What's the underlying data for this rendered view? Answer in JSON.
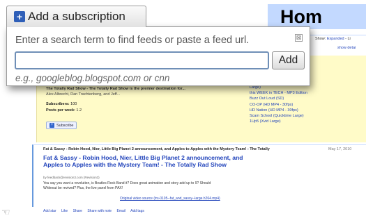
{
  "header": {
    "add_subscription_label": "Add a subscription",
    "page_title": "Hom"
  },
  "subscribe_popup": {
    "hint": "Enter a search term to find feeds or paste a feed url.",
    "input_value": "",
    "add_button_label": "Add",
    "close_glyph": "⊠",
    "example": "e.g., googleblog.blogspot.com or cnn"
  },
  "reader": {
    "toolbar": {
      "show_prefix": "Show: ",
      "show_expanded": "Expanded",
      "show_sep": " - Li",
      "show_details": "show detai"
    },
    "feed": {
      "heading": "The Totally Rad Show - The Totally Rad Show is the premier destination for...",
      "description": "Alex Albrecht, Dan Trachtenberg, and Jeff...",
      "subscribers_label": "Subscribers:",
      "subscribers_value": "100",
      "posts_label": "Posts per week:",
      "posts_value": "1.2",
      "subscribe_label": "Subscribe"
    },
    "links": [
      "Large)",
      "this WEEK in TECH - MP3 Edition",
      "Buzz Out Loud (SD)",
      "CO-OP (HD MP4 - 30fps)",
      "HD Nation (HD MP4 - 30fps)",
      "Scam School (Quicktime Large)",
      "1Up5 (Xvid Large)"
    ],
    "item": {
      "header": "Fat & Sassy - Robin Hood, Nier, Little Big Planet 2 announcement, and Apples to Apples with the Mystery Team! - The Totally",
      "date": "May 17, 2010",
      "title": "Fat & Sassy - Robin Hood, Nier, Little Big Planet 2 announcement, and Apples to Apples with the Mystery Team! - The Totally Rad Show",
      "byline": "by feedback@revision3.com (Revision3)",
      "body_line1": "You say you want a revolution, is Beatles Rock Band it? Does great animation and story add up to 9? Should",
      "body_line2": "Whiteout be revived? Plus, the live panel from PAX!",
      "video_link": "Original video source (trs-0105--fat_and_sassy--large.h264.mp4)",
      "actions": [
        "Add star",
        "Like",
        "Share",
        "Share with note",
        "Email",
        "Add tags"
      ]
    }
  },
  "colors": {
    "accent_blue": "#2f5fb8",
    "link_blue": "#2244bb",
    "home_bar": "#c3d9ff",
    "feed_highlight": "#fffbc8"
  }
}
